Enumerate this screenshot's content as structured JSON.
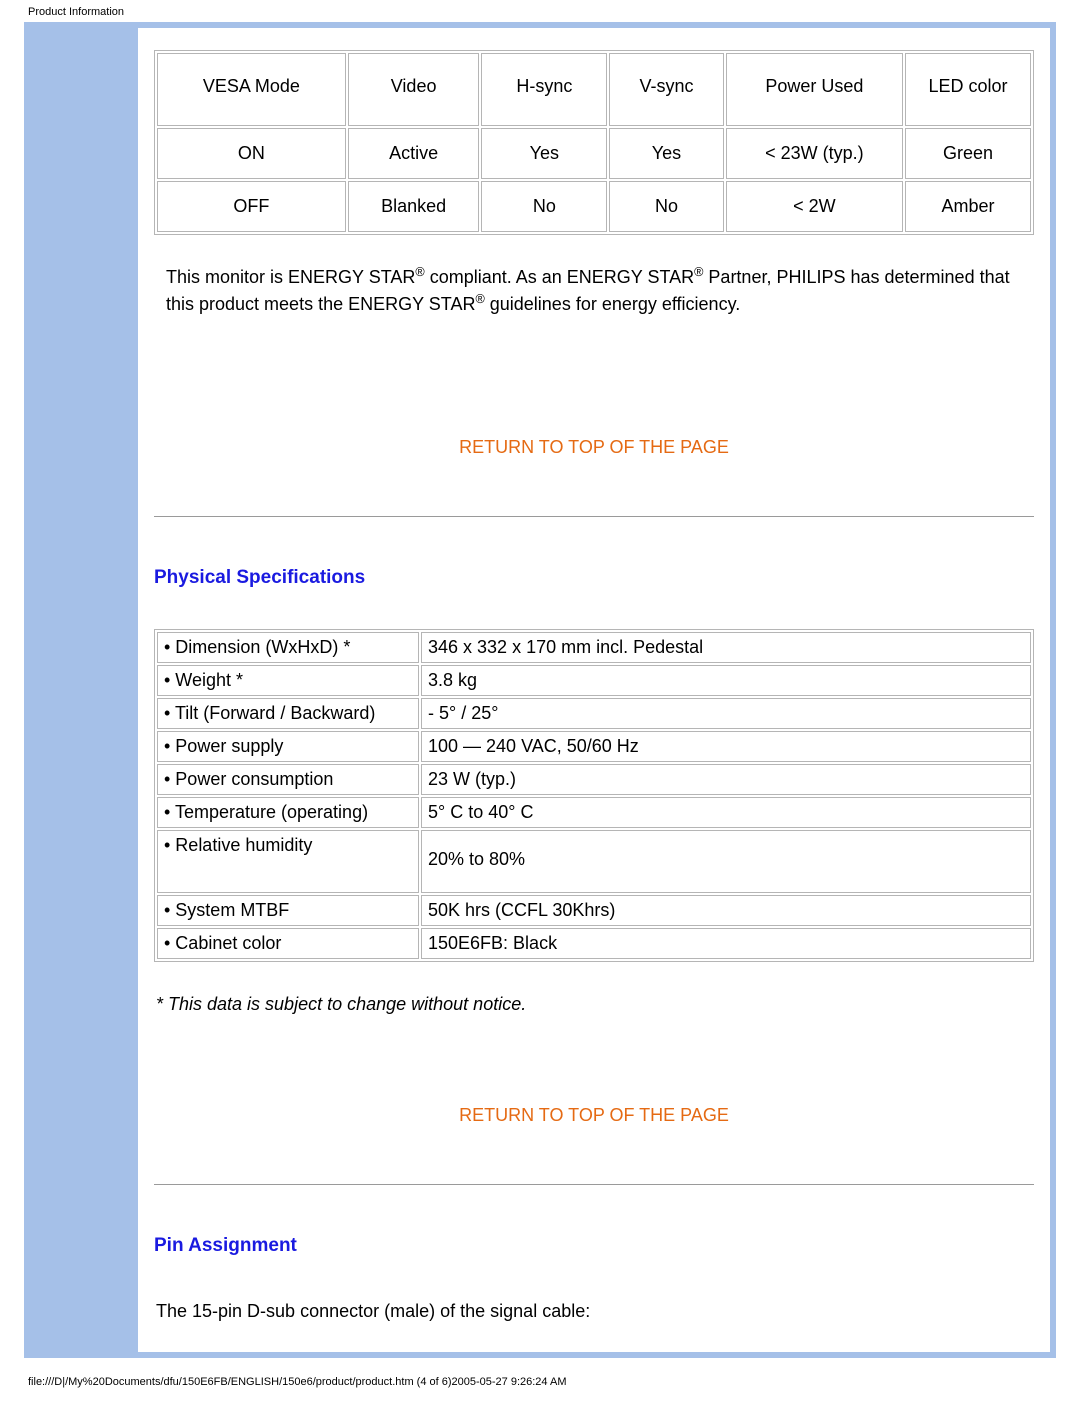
{
  "header_title": "Product Information",
  "power_table": {
    "headers": [
      "VESA Mode",
      "Video",
      "H-sync",
      "V-sync",
      "Power Used",
      "LED color"
    ],
    "rows": [
      [
        "ON",
        "Active",
        "Yes",
        "Yes",
        "< 23W (typ.)",
        "Green"
      ],
      [
        "OFF",
        "Blanked",
        "No",
        "No",
        "< 2W",
        "Amber"
      ]
    ]
  },
  "energy_star_text": {
    "p1a": "This monitor is ",
    "es_caps": "ENERGY STAR",
    "p1b": " compliant. As an ",
    "p1c": " Partner, ",
    "philips": "PHILIPS",
    "p1d": " has determined that this product meets the ",
    "p1e": " guidelines for energy efficiency."
  },
  "return_link": "RETURN TO TOP OF THE PAGE",
  "physical_specs_title": "Physical Specifications",
  "phys_table": [
    [
      "• Dimension (WxHxD) *",
      "346 x 332 x 170 mm incl. Pedestal"
    ],
    [
      "• Weight *",
      "3.8 kg"
    ],
    [
      "• Tilt (Forward / Backward)",
      "- 5° / 25°"
    ],
    [
      "• Power supply",
      "100 — 240 VAC, 50/60 Hz"
    ],
    [
      "• Power consumption",
      "23 W (typ.)"
    ],
    [
      "• Temperature (operating)",
      "5° C to 40° C"
    ],
    [
      "• Relative humidity",
      "20% to 80%"
    ],
    [
      "• System MTBF",
      "50K hrs (CCFL 30Khrs)"
    ],
    [
      "• Cabinet color",
      "150E6FB: Black"
    ]
  ],
  "footnote": "* This data is subject to change without notice.",
  "pin_assignment_title": "Pin Assignment",
  "pin_text": "The 15-pin D-sub connector (male) of the signal cable:",
  "footer": "file:///D|/My%20Documents/dfu/150E6FB/ENGLISH/150e6/product/product.htm (4 of 6)2005-05-27 9:26:24 AM"
}
